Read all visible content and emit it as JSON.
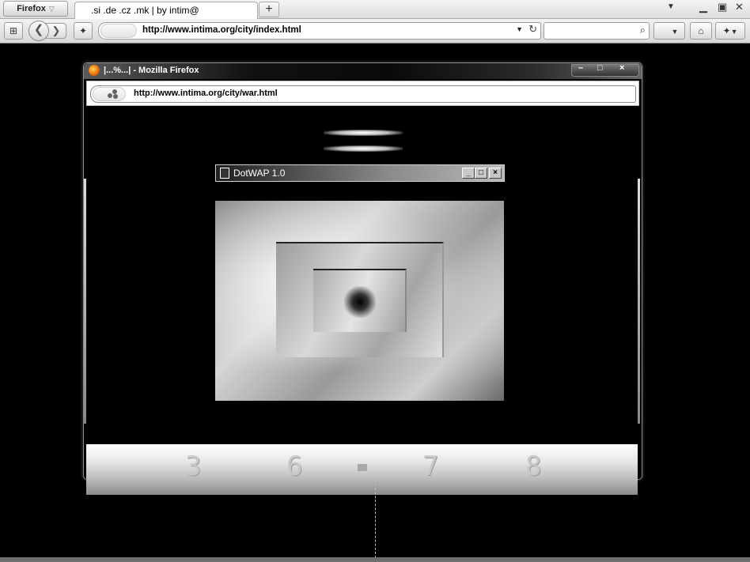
{
  "browser": {
    "menu_label": "Firefox",
    "tab_title": ".si .de .cz .mk | by intim@",
    "new_tab_symbol": "+",
    "tab_list_symbol": "▼",
    "minimize_symbol": "▁",
    "restore_symbol": "▣",
    "close_symbol": "✕",
    "url": "http://www.intima.org/city/index.html",
    "search_value": ""
  },
  "popup": {
    "title": "|...%...| - Mozilla Firefox",
    "url": "http://www.intima.org/city/war.html",
    "min_symbol": "–",
    "max_symbol": "□",
    "close_symbol": "×"
  },
  "dotwap": {
    "title": "DotWAP 1.0",
    "min_symbol": "_",
    "max_symbol": "□",
    "close_symbol": "×"
  },
  "digits": [
    "3",
    "6",
    "7",
    "8"
  ],
  "colors": {
    "page_bg": "#000000",
    "chrome": "#dcdcdc",
    "firefox_orange": "#e46a10"
  }
}
